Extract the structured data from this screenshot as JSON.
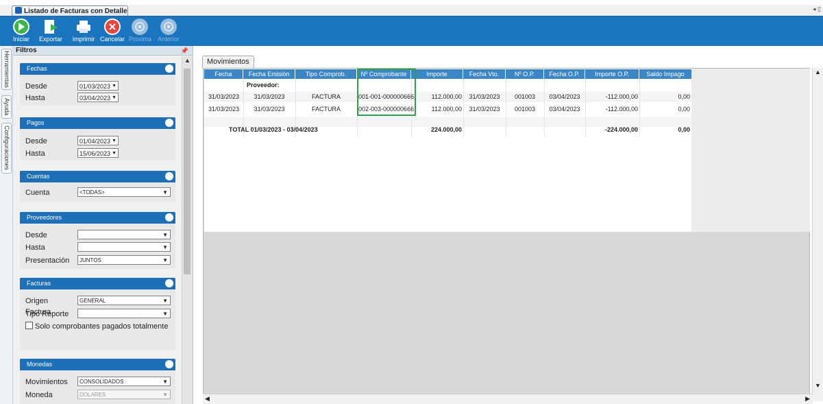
{
  "window": {
    "tab_title": "Listado de Facturas con Detalle d..."
  },
  "toolbar": {
    "buttons": [
      {
        "label": "Iniciar",
        "icon": "play-icon",
        "enabled": true
      },
      {
        "label": "Exportar",
        "icon": "export-icon",
        "enabled": true
      },
      {
        "label": "Imprimir",
        "icon": "print-icon",
        "enabled": true
      },
      {
        "label": "Cancelar",
        "icon": "cancel-icon",
        "enabled": true
      },
      {
        "label": "Proxima",
        "icon": "next-icon",
        "enabled": false
      },
      {
        "label": "Anterior",
        "icon": "previous-icon",
        "enabled": false
      }
    ]
  },
  "side_tabs": [
    "Herramientas",
    "Ayuda",
    "Configuraciones"
  ],
  "filters": {
    "title": "Filtros",
    "fechas": {
      "title": "Fechas",
      "desde_label": "Desde",
      "desde": "01/03/2023",
      "hasta_label": "Hasta",
      "hasta": "03/04/2023"
    },
    "pagos": {
      "title": "Pagos",
      "desde_label": "Desde",
      "desde": "01/04/2023",
      "hasta_label": "Hasta",
      "hasta": "15/06/2023"
    },
    "cuentas": {
      "title": "Cuentas",
      "cuenta_label": "Cuenta",
      "cuenta": "<TODAS>"
    },
    "proveedores": {
      "title": "Proveedores",
      "desde_label": "Desde",
      "desde": "",
      "hasta_label": "Hasta",
      "hasta": "",
      "presentacion_label": "Presentación",
      "presentacion": "JUNTOS"
    },
    "facturas": {
      "title": "Facturas",
      "origen_label": "Origen Factura",
      "origen": "GENERAL",
      "tipo_label": "Tipo Reporte",
      "tipo": "",
      "solo_pagados_label": "Solo comprobantes pagados totalmente"
    },
    "monedas": {
      "title": "Monedas",
      "movimientos_label": "Movimientos",
      "movimientos": "CONSOLIDADOS",
      "moneda_label": "Moneda",
      "moneda": "DOLARES"
    }
  },
  "main": {
    "tab_label": "Movimientos",
    "columns": [
      "Fecha",
      "Fecha Emisión",
      "Tipo Comprob.",
      "Nº Comprobante",
      "Importe",
      "Fecha Vto.",
      "Nº O.P.",
      "Fecha O.P.",
      "Importe O.P.",
      "Saldo Impago"
    ],
    "group_label": "Proveedor:",
    "rows": [
      [
        "31/03/2023",
        "31/03/2023",
        "FACTURA",
        "001-001-000000666",
        "112.000,00",
        "31/03/2023",
        "001003",
        "03/04/2023",
        "-112.000,00",
        "0,00"
      ],
      [
        "31/03/2023",
        "31/03/2023",
        "FACTURA",
        "002-003-000000666",
        "112.000,00",
        "31/03/2023",
        "001003",
        "03/04/2023",
        "-112.000,00",
        "0,00"
      ]
    ],
    "total": {
      "label": "TOTAL 01/03/2023 - 03/04/2023",
      "importe": "224.000,00",
      "importe_op": "-224.000,00",
      "saldo": "0,00"
    }
  },
  "colors": {
    "toolbar_bg": "#1b74be",
    "group_header": "#1d6fb8",
    "grid_header": "#3d86c6",
    "highlight": "#2ea04a"
  }
}
